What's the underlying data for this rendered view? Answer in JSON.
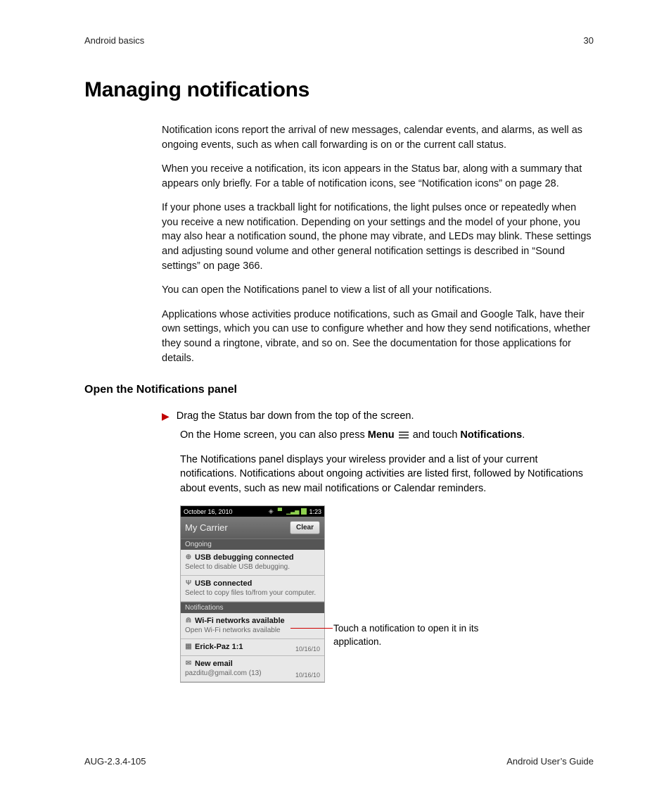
{
  "header": {
    "section": "Android basics",
    "page_number": "30"
  },
  "title": "Managing notifications",
  "paras": [
    "Notification icons report the arrival of new messages, calendar events, and alarms, as well as ongoing events, such as when call forwarding is on or the current call status.",
    "When you receive a notification, its icon appears in the Status bar, along with a summary that appears only briefly. For a table of notification icons, see “Notification icons” on page 28.",
    "If your phone uses a trackball light for notifications, the light pulses once or repeatedly when you receive a new notification. Depending on your settings and the model of your phone, you may also hear a notification sound, the phone may vibrate, and LEDs may blink. These settings and adjusting sound volume and other general notification settings is described in “Sound settings” on page 366.",
    "You can open the Notifications panel to view a list of all your notifications.",
    "Applications whose activities produce notifications, such as Gmail and Google Talk, have their own settings, which you can use to configure whether and how they send notifications, whether they sound a ringtone, vibrate, and so on. See the documentation for those applications for details."
  ],
  "subhead": "Open the Notifications panel",
  "step_text": "Drag the Status bar down from the top of the screen.",
  "step_sub_pre": "On the Home screen, you can also press ",
  "step_sub_menu": "Menu",
  "step_sub_mid": " and touch ",
  "step_sub_notif": "Notifications",
  "step_sub_end": ".",
  "step_para": "The Notifications panel displays your wireless provider and a list of your current notifications. Notifications about ongoing activities are listed first, followed by Notifications about events, such as new mail notifications or Calendar reminders.",
  "figure": {
    "status_date": "October 16, 2010",
    "status_time": "1:23",
    "carrier": "My Carrier",
    "clear": "Clear",
    "ongoing_label": "Ongoing",
    "notifications_label": "Notifications",
    "items": [
      {
        "title": "USB debugging connected",
        "sub": "Select to disable USB debugging.",
        "date": ""
      },
      {
        "title": "USB connected",
        "sub": "Select to copy files to/from your computer.",
        "date": ""
      },
      {
        "title": "Wi-Fi networks available",
        "sub": "Open Wi-Fi networks available",
        "date": ""
      },
      {
        "title": "Erick-Paz 1:1",
        "sub": "",
        "date": "10/16/10"
      },
      {
        "title": "New email",
        "sub": "pazditu@gmail.com (13)",
        "date": "10/16/10"
      }
    ]
  },
  "callout": "Touch a notification to open it in its application.",
  "footer": {
    "left": "AUG-2.3.4-105",
    "right": "Android User’s Guide"
  }
}
